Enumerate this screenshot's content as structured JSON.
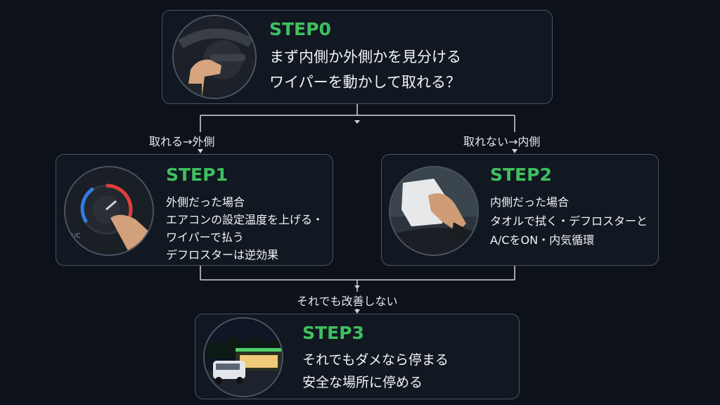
{
  "colors": {
    "background": "#0c111a",
    "card": "#111821",
    "border": "#4b5563",
    "step_accent": "#3fbf5f",
    "connector": "#d1d5db"
  },
  "step0": {
    "title": "STEP0",
    "lines": [
      "まず内側か外側かを見分ける",
      "ワイパーを動かして取れる？"
    ],
    "image_icon": "hand-on-wiper-lever"
  },
  "branches": {
    "left": "取れる→外側",
    "right": "取れない→内側",
    "bottom": "それでも改善しない"
  },
  "step1": {
    "title": "STEP1",
    "lines": [
      "外側だった場合",
      "エアコンの設定温度を上げる・",
      "ワイパーで払う",
      "デフロスターは逆効果"
    ],
    "image_icon": "ac-temperature-dial"
  },
  "step2": {
    "title": "STEP2",
    "lines": [
      "内側だった場合",
      "タオルで拭く・デフロスターと",
      "A/CをON・内気循環"
    ],
    "image_icon": "towel-wiping-glass"
  },
  "step3": {
    "title": "STEP3",
    "lines": [
      "それでもダメなら停まる",
      "安全な場所に停める"
    ],
    "image_icon": "car-parked-at-store"
  }
}
